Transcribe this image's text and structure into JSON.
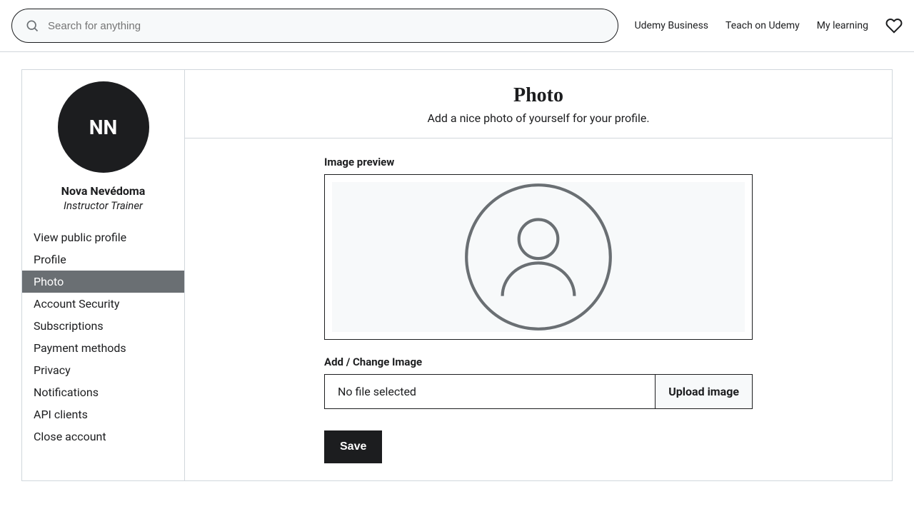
{
  "search": {
    "placeholder": "Search for anything"
  },
  "header_links": {
    "business": "Udemy Business",
    "teach": "Teach on Udemy",
    "learning": "My learning"
  },
  "sidebar": {
    "avatar_initials": "NN",
    "user_name": "Nova Nevédoma",
    "user_role": "Instructor Trainer",
    "items": [
      {
        "label": "View public profile"
      },
      {
        "label": "Profile"
      },
      {
        "label": "Photo"
      },
      {
        "label": "Account Security"
      },
      {
        "label": "Subscriptions"
      },
      {
        "label": "Payment methods"
      },
      {
        "label": "Privacy"
      },
      {
        "label": "Notifications"
      },
      {
        "label": "API clients"
      },
      {
        "label": "Close account"
      }
    ]
  },
  "main": {
    "title": "Photo",
    "subtitle": "Add a nice photo of yourself for your profile.",
    "preview_label": "Image preview",
    "change_label": "Add / Change Image",
    "no_file": "No file selected",
    "upload_btn": "Upload image",
    "save_btn": "Save"
  }
}
